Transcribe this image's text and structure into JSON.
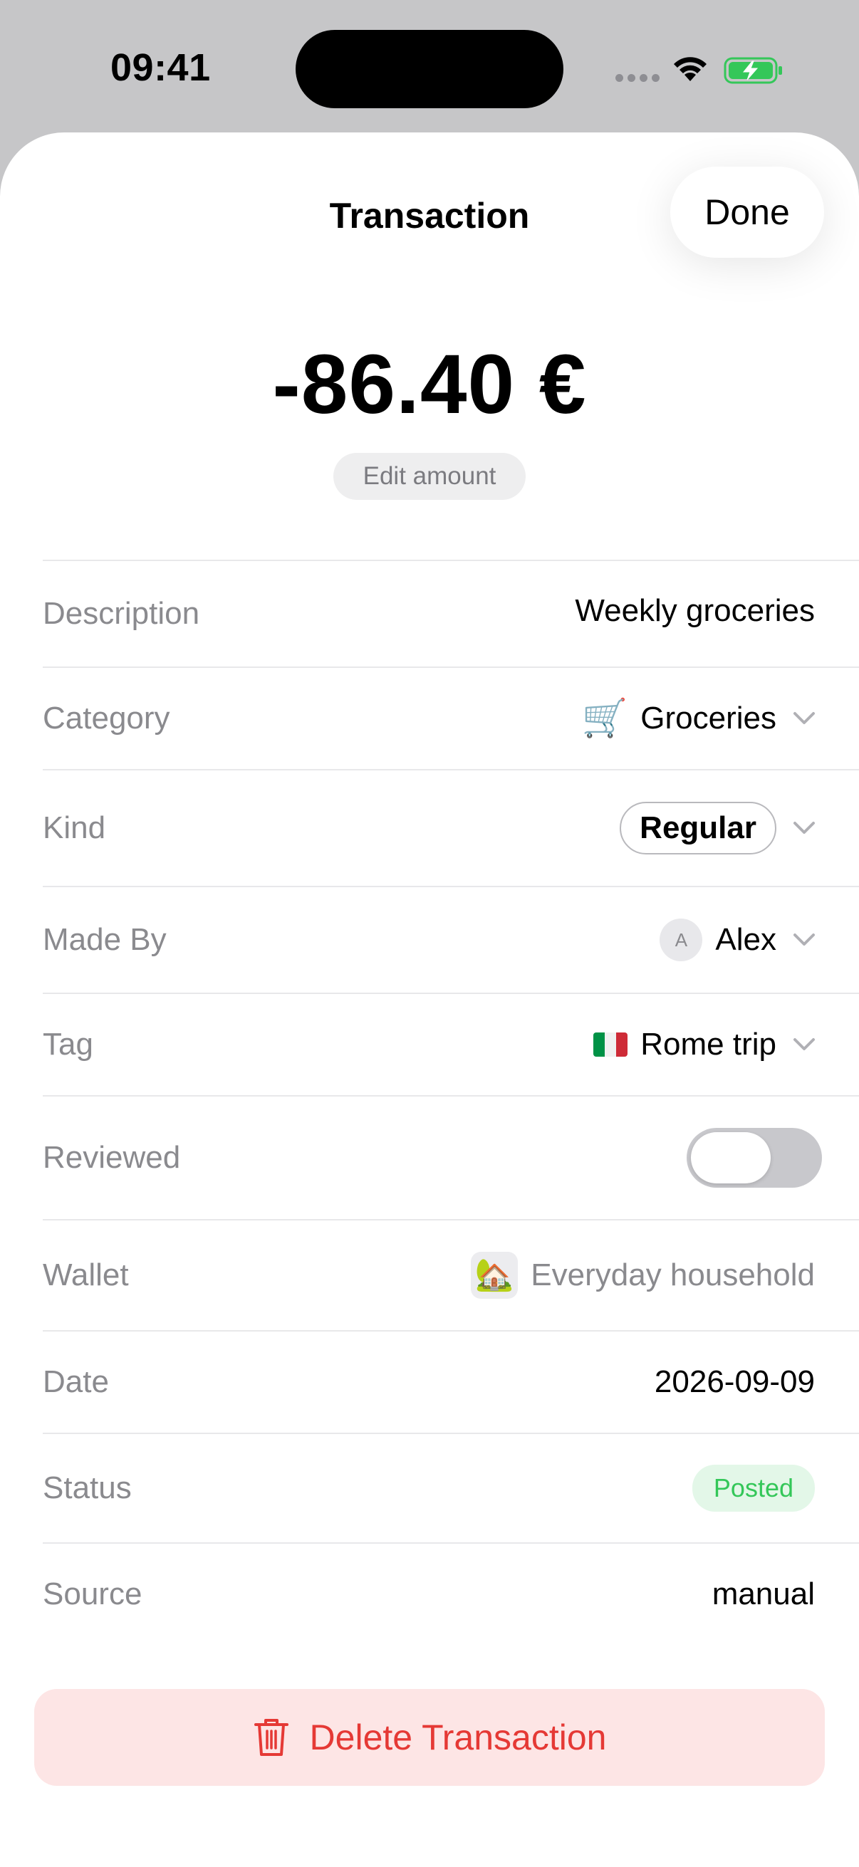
{
  "status_bar": {
    "time": "09:41"
  },
  "nav": {
    "title": "Transaction",
    "done_label": "Done"
  },
  "amount": {
    "display": "-86.40 €",
    "edit_label": "Edit amount"
  },
  "rows": {
    "description": {
      "label": "Description",
      "value": "Weekly groceries"
    },
    "category": {
      "label": "Category",
      "icon": "🛒",
      "value": "Groceries"
    },
    "kind": {
      "label": "Kind",
      "value": "Regular"
    },
    "made_by": {
      "label": "Made By",
      "avatar_initial": "A",
      "value": "Alex"
    },
    "tag": {
      "label": "Tag",
      "value": "Rome trip"
    },
    "reviewed": {
      "label": "Reviewed",
      "toggle_on": false
    },
    "wallet": {
      "label": "Wallet",
      "icon": "🏡",
      "value": "Everyday household"
    },
    "date": {
      "label": "Date",
      "value": "2026-09-09"
    },
    "status": {
      "label": "Status",
      "value": "Posted",
      "badge_color": "#34c759"
    },
    "source": {
      "label": "Source",
      "value": "manual"
    }
  },
  "delete": {
    "label": "Delete Transaction",
    "color": "#e53935"
  },
  "icons": {
    "status_bar": [
      "signal-dots-icon",
      "wifi-icon",
      "battery-charging-icon"
    ],
    "chevron": "chevron-down-icon",
    "delete": "trash-icon",
    "tag_flag": "italy-flag-icon"
  }
}
